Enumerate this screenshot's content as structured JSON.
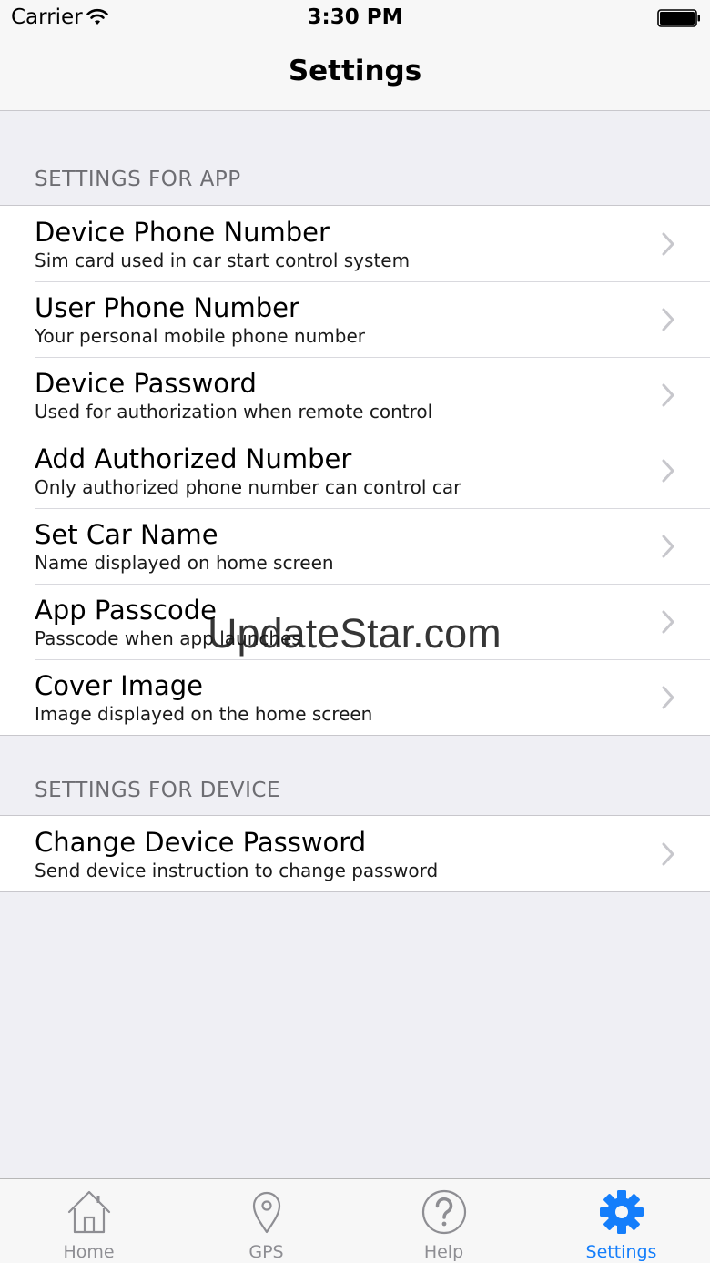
{
  "status_bar": {
    "carrier": "Carrier",
    "time": "3:30 PM"
  },
  "nav": {
    "title": "Settings"
  },
  "sections": [
    {
      "header": "SETTINGS FOR APP",
      "rows": [
        {
          "title": "Device Phone Number",
          "subtitle": "Sim card used in car start control system"
        },
        {
          "title": "User Phone Number",
          "subtitle": "Your personal mobile phone number"
        },
        {
          "title": "Device Password",
          "subtitle": "Used for authorization when remote control"
        },
        {
          "title": "Add Authorized Number",
          "subtitle": "Only authorized phone number can control car"
        },
        {
          "title": "Set Car Name",
          "subtitle": "Name displayed on home screen"
        },
        {
          "title": "App Passcode",
          "subtitle": "Passcode when app launches"
        },
        {
          "title": "Cover Image",
          "subtitle": "Image displayed on the home screen"
        }
      ]
    },
    {
      "header": "SETTINGS FOR DEVICE",
      "rows": [
        {
          "title": "Change Device Password",
          "subtitle": "Send device instruction to change password"
        }
      ]
    }
  ],
  "watermark": "UpdateStar.com",
  "tabs": [
    {
      "label": "Home",
      "icon": "home-icon"
    },
    {
      "label": "GPS",
      "icon": "map-pin-icon"
    },
    {
      "label": "Help",
      "icon": "question-circle-icon"
    },
    {
      "label": "Settings",
      "icon": "gear-icon",
      "active": true
    }
  ],
  "colors": {
    "accent": "#147efb",
    "inactive": "#8e8e93",
    "background": "#efeff4"
  }
}
